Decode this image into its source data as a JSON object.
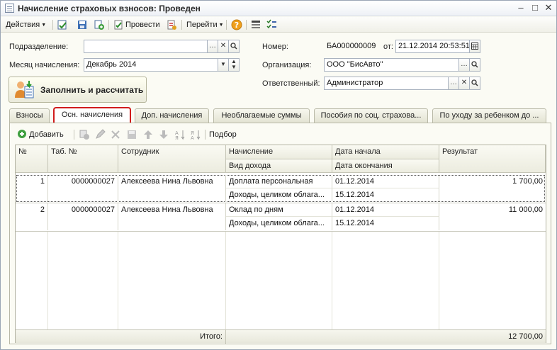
{
  "window": {
    "title": "Начисление страховых взносов: Проведен"
  },
  "toolbar": {
    "actions_label": "Действия",
    "post_label": "Провести",
    "goto_label": "Перейти"
  },
  "form": {
    "subdivision_label": "Подразделение:",
    "subdivision_value": "",
    "month_label": "Месяц начисления:",
    "month_value": "Декабрь 2014",
    "number_label": "Номер:",
    "number_value": "БА000000009",
    "from_label": "от:",
    "date_value": "21.12.2014 20:53:51",
    "org_label": "Организация:",
    "org_value": "ООО \"БисАвто\"",
    "resp_label": "Ответственный:",
    "resp_value": "Администратор",
    "fill_button": "Заполнить и рассчитать"
  },
  "tabs": [
    {
      "label": "Взносы"
    },
    {
      "label": "Осн. начисления"
    },
    {
      "label": "Доп. начисления"
    },
    {
      "label": "Необлагаемые суммы"
    },
    {
      "label": "Пособия по соц. страхова..."
    },
    {
      "label": "По уходу за ребенком до ..."
    }
  ],
  "grid_toolbar": {
    "add_label": "Добавить",
    "select_label": "Подбор"
  },
  "grid": {
    "headers": {
      "num": "№",
      "tab_num": "Таб. №",
      "employee": "Сотрудник",
      "accrual": "Начисление",
      "income_type": "Вид дохода",
      "start_date": "Дата начала",
      "end_date": "Дата окончания",
      "result": "Результат"
    },
    "rows": [
      {
        "num": "1",
        "tab_num": "0000000027",
        "employee": "Алексеева Нина Львовна",
        "accrual": "Доплата персональная",
        "income_type": "Доходы, целиком облага...",
        "start_date": "01.12.2014",
        "end_date": "15.12.2014",
        "result": "1 700,00"
      },
      {
        "num": "2",
        "tab_num": "0000000027",
        "employee": "Алексеева Нина Львовна",
        "accrual": "Оклад по дням",
        "income_type": "Доходы, целиком облага...",
        "start_date": "01.12.2014",
        "end_date": "15.12.2014",
        "result": "11 000,00"
      }
    ],
    "footer": {
      "total_label": "Итого:",
      "total_value": "12 700,00"
    }
  }
}
